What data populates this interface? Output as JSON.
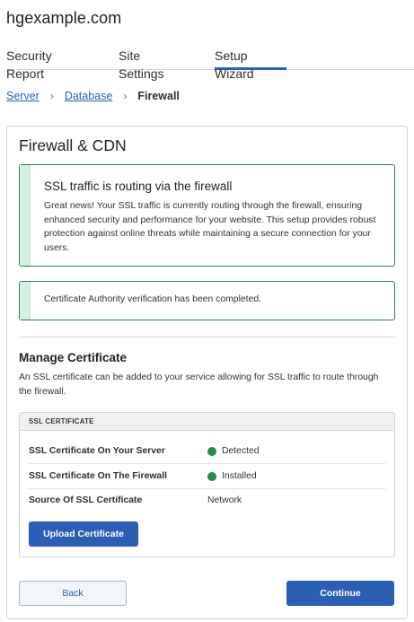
{
  "header": {
    "site_title": "hgexample.com"
  },
  "tabs": [
    {
      "label": "Security Report",
      "active": false
    },
    {
      "label": "Site Settings",
      "active": false
    },
    {
      "label": "Setup Wizard",
      "active": true
    }
  ],
  "breadcrumb": {
    "items": [
      "Server",
      "Database"
    ],
    "current": "Firewall",
    "separator": "›"
  },
  "card": {
    "title": "Firewall & CDN",
    "success_alert": {
      "title": "SSL traffic is routing via the firewall",
      "body": "Great news! Your SSL traffic is currently routing through the firewall, ensuring enhanced security and performance for your website. This setup provides robust protection against online threats while maintaining a secure connection for your users."
    },
    "info_alert": {
      "message": "Certificate Authority verification has been completed."
    },
    "manage": {
      "title": "Manage Certificate",
      "description": "An SSL certificate can be added to your service allowing for SSL traffic to route through the firewall."
    },
    "certificate": {
      "header": "SSL CERTIFICATE",
      "rows": [
        {
          "label": "SSL Certificate On Your Server",
          "value": "Detected",
          "status_dot": true
        },
        {
          "label": "SSL Certificate On The Firewall",
          "value": "Installed",
          "status_dot": true
        },
        {
          "label": "Source Of SSL Certificate",
          "value": "Network",
          "status_dot": false
        }
      ],
      "upload_label": "Upload Certificate"
    },
    "actions": {
      "back_label": "Back",
      "continue_label": "Continue"
    }
  },
  "colors": {
    "accent": "#2b5fb4",
    "success": "#1f8a52",
    "success_bar": "#d8efe3"
  }
}
